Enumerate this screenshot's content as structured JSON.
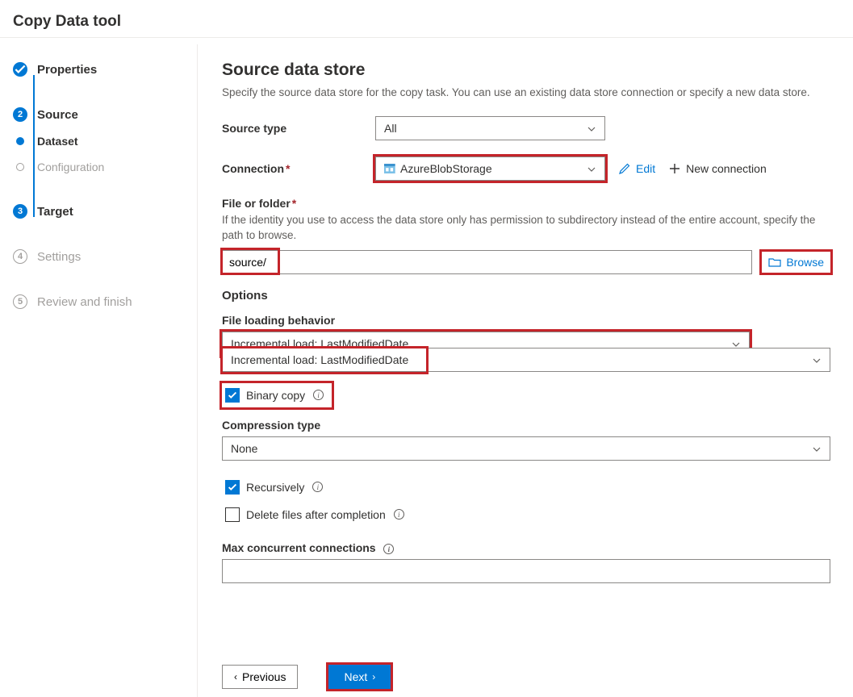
{
  "page_title": "Copy Data tool",
  "sidebar": {
    "steps": [
      {
        "id": "properties",
        "label": "Properties",
        "state": "done"
      },
      {
        "id": "source",
        "label": "Source",
        "state": "active",
        "substeps": [
          {
            "id": "dataset",
            "label": "Dataset",
            "state": "active"
          },
          {
            "id": "configuration",
            "label": "Configuration",
            "state": "pending"
          }
        ]
      },
      {
        "id": "target",
        "label": "Target",
        "state": "upcoming",
        "number": "3"
      },
      {
        "id": "settings",
        "label": "Settings",
        "state": "pending",
        "number": "4"
      },
      {
        "id": "review",
        "label": "Review and finish",
        "state": "pending",
        "number": "5"
      }
    ]
  },
  "section": {
    "title": "Source data store",
    "description": "Specify the source data store for the copy task. You can use an existing data store connection or specify a new data store."
  },
  "form": {
    "source_type_label": "Source type",
    "source_type_value": "All",
    "connection_label": "Connection",
    "connection_value": "AzureBlobStorage",
    "edit_label": "Edit",
    "new_connection_label": "New connection",
    "file_folder_label": "File or folder",
    "file_folder_help": "If the identity you use to access the data store only has permission to subdirectory instead of the entire account, specify the path to browse.",
    "file_folder_value": "source/",
    "browse_label": "Browse",
    "options_label": "Options",
    "file_loading_label": "File loading behavior",
    "file_loading_value": "Incremental load: LastModifiedDate",
    "binary_copy_label": "Binary copy",
    "compression_label": "Compression type",
    "compression_value": "None",
    "recursively_label": "Recursively",
    "delete_label": "Delete files after completion",
    "max_conn_label": "Max concurrent connections",
    "max_conn_value": ""
  },
  "footer": {
    "previous_label": "Previous",
    "next_label": "Next"
  }
}
